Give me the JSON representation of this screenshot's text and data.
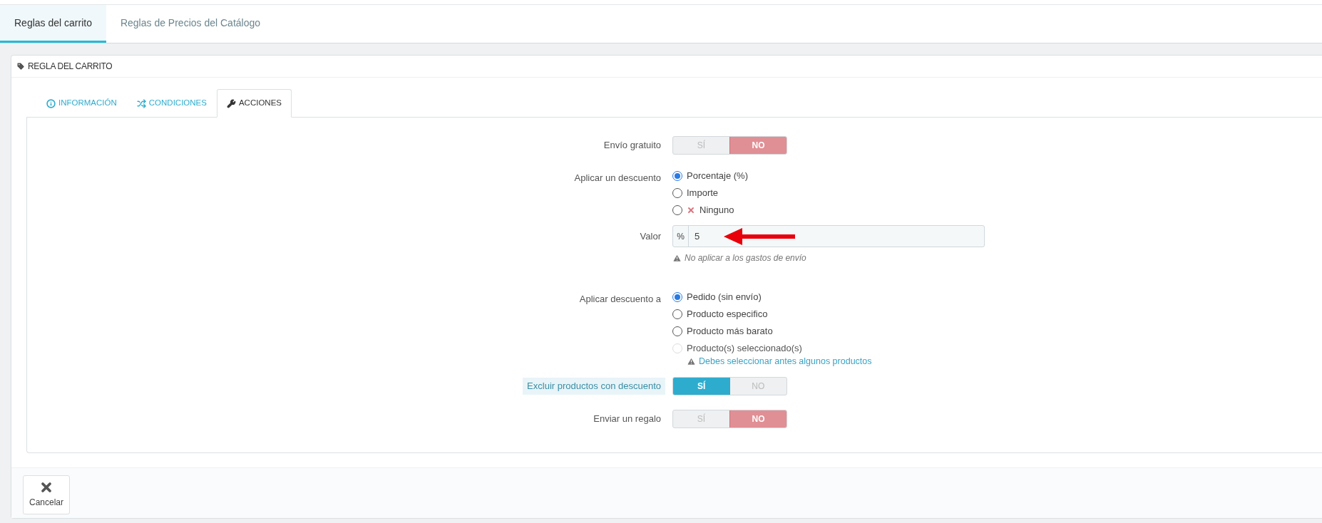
{
  "top_tabs": [
    {
      "label": "Reglas del carrito",
      "selected": true
    },
    {
      "label": "Reglas de Precios del Catálogo",
      "selected": false
    }
  ],
  "panel": {
    "title": "REGLA DEL CARRITO"
  },
  "section_tabs": [
    {
      "label": "INFORMACIÓN",
      "kind": "info",
      "selected": false
    },
    {
      "label": "CONDICIONES",
      "kind": "shuffle",
      "selected": false
    },
    {
      "label": "ACCIONES",
      "kind": "wrench",
      "selected": true
    }
  ],
  "form": [
    {
      "kind": "switch",
      "label": "Envío gratuito",
      "yes": "SÍ",
      "no": "NO",
      "on": false,
      "highlighted": false
    },
    {
      "kind": "radio",
      "label": "Aplicar un descuento",
      "options": [
        {
          "label": "Porcentaje (%)",
          "selected": true,
          "disabled": false
        },
        {
          "label": "Importe",
          "selected": false,
          "disabled": false
        },
        {
          "label": "Ninguno",
          "selected": false,
          "disabled": false,
          "kind": "remove"
        }
      ]
    },
    {
      "kind": "input",
      "label": "Valor",
      "addon": "%",
      "value": "5",
      "hint": "No aplicar a los gastos de envío",
      "annotated": true
    },
    {
      "kind": "radio",
      "label": "Aplicar descuento a",
      "options": [
        {
          "label": "Pedido (sin envío)",
          "selected": true,
          "disabled": false
        },
        {
          "label": "Producto especifico",
          "selected": false,
          "disabled": false
        },
        {
          "label": "Producto más barato",
          "selected": false,
          "disabled": false
        },
        {
          "label": "Producto(s) seleccionado(s)",
          "selected": false,
          "disabled": true,
          "note": "Debes seleccionar antes algunos productos"
        }
      ]
    },
    {
      "kind": "switch",
      "label": "Excluir productos con descuento",
      "yes": "SÍ",
      "no": "NO",
      "on": true,
      "highlighted": true
    },
    {
      "kind": "switch",
      "label": "Enviar un regalo",
      "yes": "SÍ",
      "no": "NO",
      "on": false,
      "highlighted": false
    }
  ],
  "footer": {
    "buttons": [
      {
        "label": "Cancelar"
      }
    ]
  }
}
